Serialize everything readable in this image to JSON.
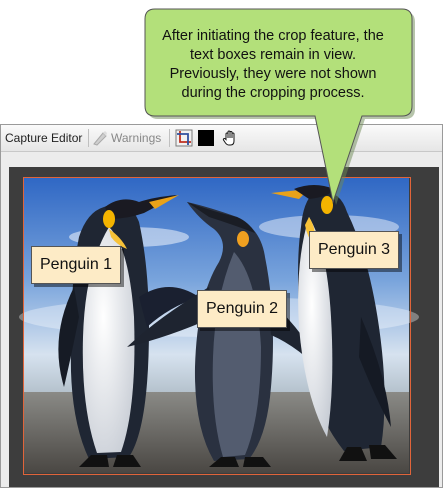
{
  "toolbar": {
    "capture_editor_label": "Capture Editor",
    "warnings_label": "Warnings"
  },
  "callouts": [
    {
      "label": "Penguin 1"
    },
    {
      "label": "Penguin 2"
    },
    {
      "label": "Penguin 3"
    }
  ],
  "annotation": {
    "lines": [
      "After initiating the crop feature, the",
      "text boxes remain in view.",
      "Previously, they were not shown",
      "during the cropping process."
    ]
  },
  "colors": {
    "bubble_fill": "#b3e07a",
    "callout_fill": "#fdebc6",
    "crop_frame": "#e0643a"
  }
}
